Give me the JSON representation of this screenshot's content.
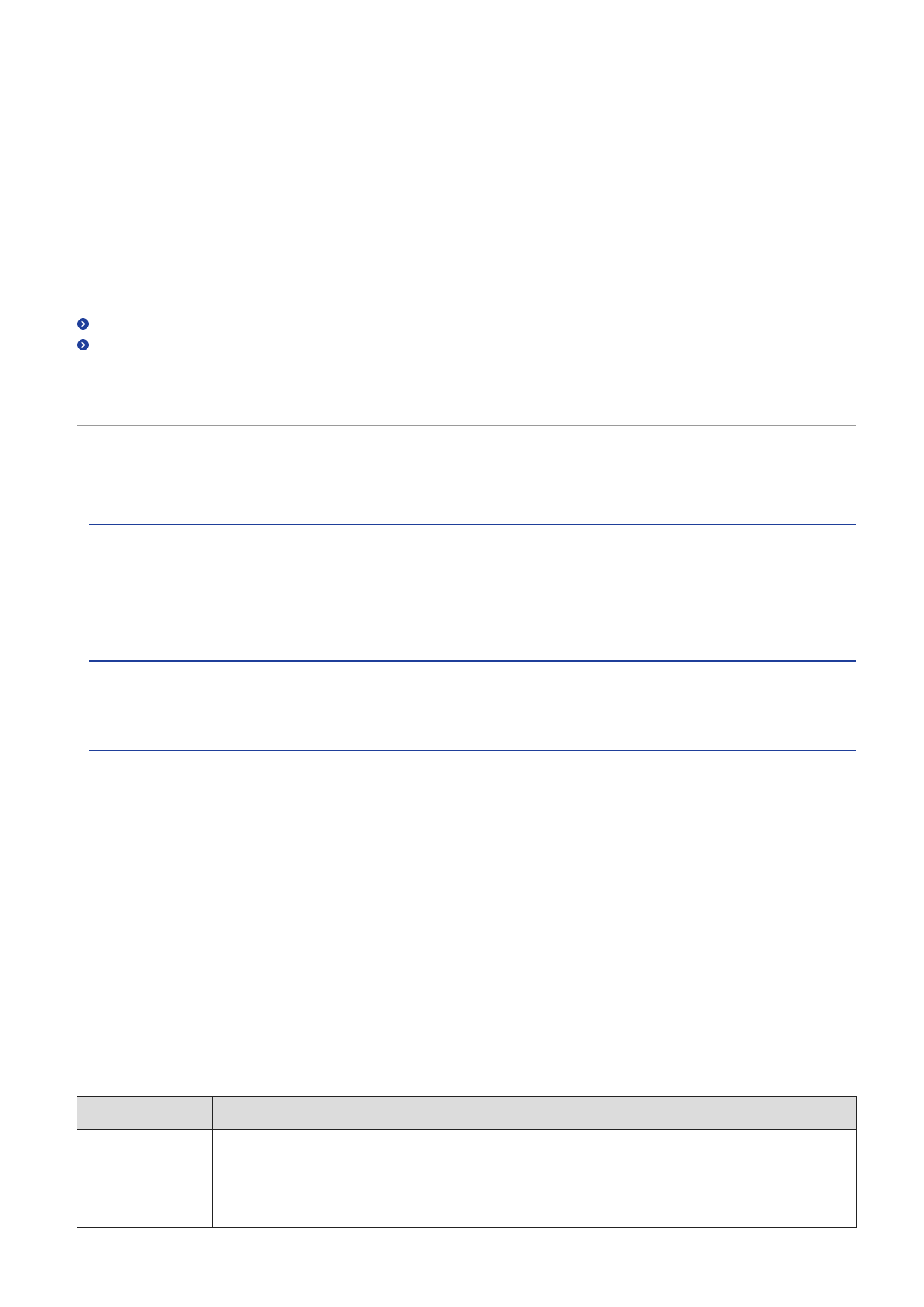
{
  "section_links": [
    {
      "icon": "chevron-circle-right-icon",
      "text": ""
    },
    {
      "icon": "chevron-circle-right-icon",
      "text": ""
    }
  ],
  "table": {
    "headers": [
      "",
      ""
    ],
    "rows": [
      [
        "",
        ""
      ],
      [
        "",
        ""
      ],
      [
        "",
        ""
      ]
    ]
  },
  "colors": {
    "accent": "#1f3f9a",
    "rule": "#9a9a9a",
    "table_header_bg": "#dcdcdc"
  }
}
